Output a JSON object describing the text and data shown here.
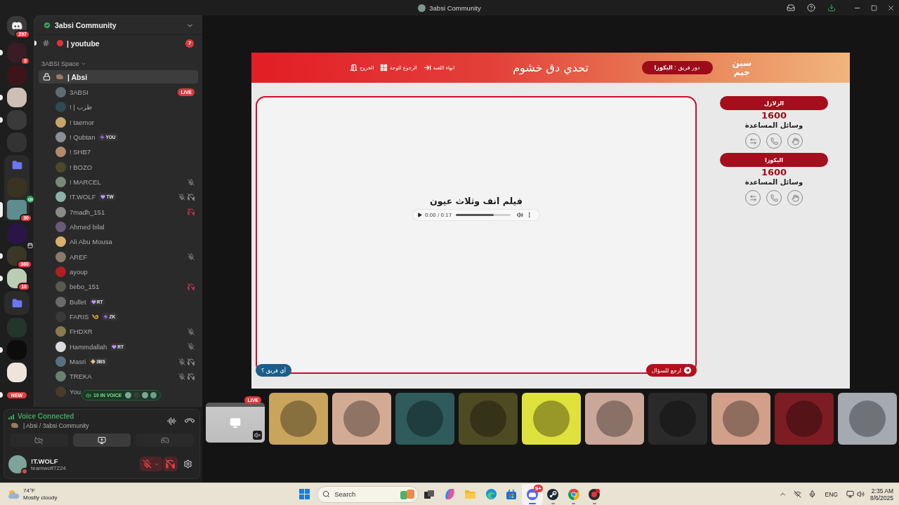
{
  "window": {
    "title": "3absi Community"
  },
  "servers": [
    {
      "kind": "home",
      "badge": "297",
      "selected": false
    },
    {
      "kind": "server",
      "badge": "3",
      "indicator": {
        "kind": "unread"
      },
      "selected": false
    },
    {
      "kind": "server",
      "selected": false
    },
    {
      "kind": "server",
      "indicator": {
        "kind": "unread"
      },
      "selected": false
    },
    {
      "kind": "server",
      "indicator": {
        "kind": "unread"
      },
      "selected": false
    },
    {
      "kind": "server",
      "selected": false
    },
    {
      "kind": "folder",
      "expanded": true,
      "children": [
        {
          "kind": "server",
          "selected": false
        },
        {
          "kind": "server",
          "badge": "30",
          "overlay": {
            "kind": "voice"
          },
          "selected": true
        }
      ]
    },
    {
      "kind": "server",
      "selected": false
    },
    {
      "kind": "server",
      "badge": "360",
      "overlay": {
        "kind": "event"
      },
      "indicator": {
        "kind": "unread"
      },
      "selected": false
    },
    {
      "kind": "server",
      "badge": "10",
      "indicator": {
        "kind": "unread"
      },
      "selected": false
    },
    {
      "kind": "folder",
      "expanded": false
    },
    {
      "kind": "server",
      "selected": false
    },
    {
      "kind": "server",
      "indicator": {
        "kind": "unread"
      },
      "selected": false
    },
    {
      "kind": "server",
      "selected": false
    },
    {
      "kind": "new",
      "badge": "NEW",
      "indicator": {
        "kind": "unread"
      }
    }
  ],
  "server_header": {
    "name": "3absi Community"
  },
  "channels": [
    {
      "kind": "text",
      "name": "| youtube",
      "badge": "7",
      "unread": true
    }
  ],
  "category": {
    "name": "3ABSI Space"
  },
  "voice_channel": {
    "name": "| Absi",
    "selected": true
  },
  "members": [
    {
      "name": "3ABSI",
      "badge": "LIVE"
    },
    {
      "name": "! | طرب"
    },
    {
      "name": "! taemor"
    },
    {
      "name": "! Qubtan",
      "tag": {
        "kind": "bolt",
        "text": "YOU"
      }
    },
    {
      "name": "! SHB7"
    },
    {
      "name": "! BOZO"
    },
    {
      "name": "! MARCEL",
      "icons": [
        {
          "kind": "muted"
        }
      ]
    },
    {
      "name": "!T.WOLF",
      "tag": {
        "kind": "heart",
        "text": "TW"
      },
      "icons": [
        {
          "kind": "muted"
        },
        {
          "kind": "deafened"
        }
      ]
    },
    {
      "name": "7madh_151",
      "icons": [
        {
          "kind": "server_deafened"
        }
      ]
    },
    {
      "name": "Ahmed bilal"
    },
    {
      "name": "Ali Abu Mousa"
    },
    {
      "name": "AREF",
      "icons": [
        {
          "kind": "muted"
        }
      ]
    },
    {
      "name": "ayoup"
    },
    {
      "name": "bebo_151",
      "icons": [
        {
          "kind": "server_deafened"
        }
      ]
    },
    {
      "name": "Bullet",
      "tag": {
        "kind": "heart",
        "text": "RT"
      }
    },
    {
      "name": "FARIS",
      "decoration": {
        "kind": "swirl"
      },
      "tag": {
        "kind": "bolt",
        "text": "ZK"
      }
    },
    {
      "name": "FHDXR",
      "icons": [
        {
          "kind": "muted"
        }
      ]
    },
    {
      "name": "Hammdallah",
      "tag": {
        "kind": "heart",
        "text": "RT"
      },
      "icons": [
        {
          "kind": "muted"
        }
      ]
    },
    {
      "name": "Masri",
      "tag": {
        "kind": "diamond",
        "text": "3BS"
      },
      "icons": [
        {
          "kind": "muted"
        },
        {
          "kind": "deafened"
        }
      ]
    },
    {
      "name": "TREKA",
      "icons": [
        {
          "kind": "muted"
        },
        {
          "kind": "deafened"
        }
      ]
    },
    {
      "name": "You"
    }
  ],
  "voice_popup": {
    "text": "10 IN VOICE"
  },
  "voice_status": {
    "title": "Voice Connected",
    "channel": "| Absi / 3absi Community"
  },
  "voice_buttons": [
    {
      "kind": "camera",
      "selected": false
    },
    {
      "kind": "screen",
      "selected": true
    },
    {
      "kind": "activity",
      "selected": false
    }
  ],
  "user": {
    "name": "!T.WOLF",
    "username": "teamwolf7224",
    "status": {
      "kind": "dnd"
    },
    "muted": true,
    "deafened": true
  },
  "game": {
    "logo": [
      "سين",
      "جيم"
    ],
    "turn": "دور فريق : **اليكوزا**",
    "title": "تحدي دق خشوم",
    "actions": [
      {
        "kind": "end",
        "label": "انهاء اللعبة"
      },
      {
        "kind": "board",
        "label": "الرجوع للوحة"
      },
      {
        "kind": "exit",
        "label": "الخروج"
      }
    ],
    "question": "فيلم انف وثلاث عيون",
    "audio": {
      "time": "0:00 / 0:17",
      "level": 0.69
    },
    "buttons": [
      {
        "kind": "back",
        "label": "ارجع للسؤال"
      },
      {
        "kind": "team",
        "label": "أي فريق ؟"
      }
    ],
    "teams": [
      {
        "name": "الزلازل",
        "score": "1600",
        "aids_label": "وسائل المساعدة",
        "aids": [
          {
            "kind": "peace"
          },
          {
            "kind": "call"
          },
          {
            "kind": "swap"
          }
        ]
      },
      {
        "name": "اليكوزا",
        "score": "1600",
        "aids_label": "وسائل المساعدة",
        "aids": [
          {
            "kind": "peace"
          },
          {
            "kind": "call"
          },
          {
            "kind": "swap"
          }
        ]
      }
    ]
  },
  "tiles": [
    {
      "kind": "stream",
      "badge": "LIVE",
      "muted": true
    },
    {
      "kind": "avatar",
      "color": "#c9a45c"
    },
    {
      "kind": "avatar",
      "color": "#d3ab95"
    },
    {
      "kind": "avatar",
      "color": "#2f5b5c"
    },
    {
      "kind": "avatar",
      "color": "#4d4b22"
    },
    {
      "kind": "avatar",
      "color": "#dfe13c"
    },
    {
      "kind": "avatar",
      "color": "#caa799"
    },
    {
      "kind": "avatar",
      "color": "#2a2a2a"
    },
    {
      "kind": "avatar",
      "color": "#d29f8b"
    },
    {
      "kind": "avatar",
      "color": "#7d1d23"
    },
    {
      "kind": "avatar",
      "color": "#a4aab0"
    }
  ],
  "taskbar": {
    "weather": {
      "temperature": "74°F",
      "condition": "Mostly cloudy"
    },
    "search": {
      "placeholder": "Search"
    },
    "apps": [
      {
        "kind": "taskview",
        "open": false,
        "selected": false
      },
      {
        "kind": "copilot",
        "open": false,
        "selected": false
      },
      {
        "kind": "explorer",
        "open": false,
        "selected": false
      },
      {
        "kind": "edge",
        "open": false,
        "selected": false
      },
      {
        "kind": "store",
        "open": false,
        "selected": false
      },
      {
        "kind": "discord",
        "badge": "9+",
        "open": true,
        "selected": true
      },
      {
        "kind": "steam",
        "open": true,
        "selected": false
      },
      {
        "kind": "chrome",
        "open": true,
        "selected": false
      },
      {
        "kind": "app",
        "open": true,
        "selected": false
      }
    ],
    "tray": {
      "language": "ENG",
      "time": "2:35 AM",
      "date": "8/6/2025"
    }
  }
}
